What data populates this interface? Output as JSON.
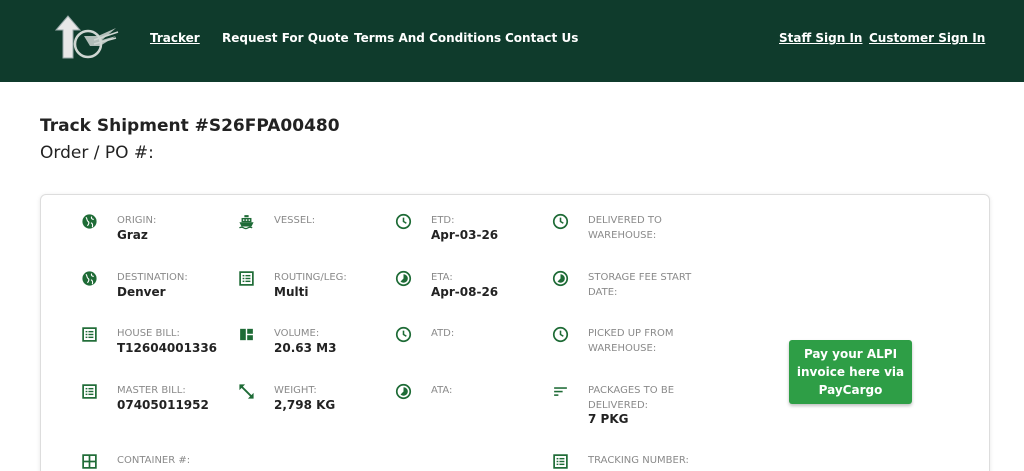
{
  "nav": {
    "tracker": "Tracker",
    "request_quote": "Request For Quote",
    "terms": "Terms And Conditions",
    "contact": "Contact Us",
    "staff_sign_in": "Staff Sign In",
    "customer_sign_in": "Customer Sign In"
  },
  "page": {
    "title": "Track Shipment #S26FPA00480",
    "subtitle": "Order / PO #:"
  },
  "fields": {
    "origin": {
      "label": "ORIGIN:",
      "value": "Graz",
      "icon": "globe-icon"
    },
    "destination": {
      "label": "DESTINATION:",
      "value": "Denver",
      "icon": "globe-icon"
    },
    "house_bill": {
      "label": "HOUSE BILL:",
      "value": "T12604001336",
      "icon": "document-list-icon"
    },
    "master_bill": {
      "label": "MASTER BILL:",
      "value": "07405011952",
      "icon": "document-list-icon"
    },
    "container": {
      "label": "CONTAINER #:",
      "value": "",
      "icon": "grid-icon"
    },
    "vessel": {
      "label": "VESSEL:",
      "value": "",
      "icon": "ship-icon"
    },
    "routing": {
      "label": "ROUTING/LEG:",
      "value": "Multi",
      "icon": "document-list-icon"
    },
    "volume": {
      "label": "VOLUME:",
      "value": "20.63 M3",
      "icon": "dashboard-icon"
    },
    "weight": {
      "label": "WEIGHT:",
      "value": "2,798 KG",
      "icon": "resize-icon"
    },
    "etd": {
      "label": "ETD:",
      "value": "Apr-03-26",
      "icon": "clock-icon"
    },
    "eta": {
      "label": "ETA:",
      "value": "Apr-08-26",
      "icon": "timelapse-icon"
    },
    "atd": {
      "label": "ATD:",
      "value": "",
      "icon": "clock-icon"
    },
    "ata": {
      "label": "ATA:",
      "value": "",
      "icon": "timelapse-icon"
    },
    "delivered_to_warehouse": {
      "label1": "DELIVERED TO",
      "label2": "WAREHOUSE:",
      "value": "",
      "icon": "clock-icon"
    },
    "storage_fee_start": {
      "label1": "STORAGE FEE START",
      "label2": "DATE:",
      "value": "",
      "icon": "timelapse-icon"
    },
    "picked_up": {
      "label1": "PICKED UP FROM",
      "label2": "WAREHOUSE:",
      "value": "",
      "icon": "clock-icon"
    },
    "packages": {
      "label1": "PACKAGES TO BE",
      "label2": "DELIVERED:",
      "value": "7 PKG",
      "icon": "sort-lines-icon"
    },
    "tracking_number": {
      "label": "TRACKING NUMBER:",
      "value": "",
      "icon": "document-list-icon"
    }
  },
  "pay_button": {
    "line1": "Pay your ALPI",
    "line2": "invoice here via",
    "line3": "PayCargo"
  },
  "colors": {
    "header_bg": "#0f3b2c",
    "icon_green": "#1e6b36",
    "button_green": "#2e9e46"
  }
}
